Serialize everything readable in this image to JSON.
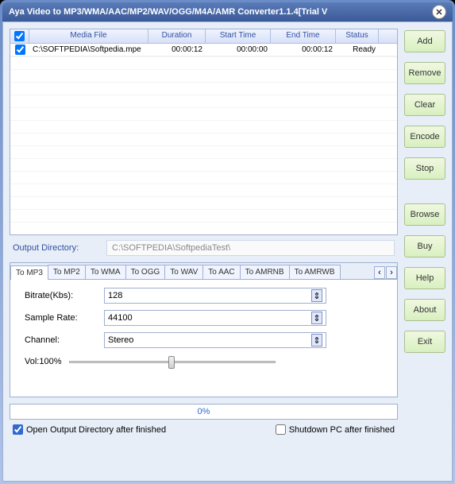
{
  "title": "Aya Video to MP3/WMA/AAC/MP2/WAV/OGG/M4A/AMR Converter1.1.4[Trial V",
  "table": {
    "headers": [
      "Media File",
      "Duration",
      "Start Time",
      "End Time",
      "Status"
    ],
    "rows": [
      {
        "checked": true,
        "file": "C:\\SOFTPEDIA\\Softpedia.mpe",
        "duration": "00:00:12",
        "start": "00:00:00",
        "end": "00:00:12",
        "status": "Ready"
      }
    ]
  },
  "sidebar": {
    "add": "Add",
    "remove": "Remove",
    "clear": "Clear",
    "encode": "Encode",
    "stop": "Stop",
    "browse": "Browse",
    "buy": "Buy",
    "help": "Help",
    "about": "About",
    "exit": "Exit"
  },
  "outdir": {
    "label": "Output Directory:",
    "value": "C:\\SOFTPEDIA\\SoftpediaTest\\"
  },
  "tabs": [
    "To MP3",
    "To MP2",
    "To WMA",
    "To OGG",
    "To WAV",
    "To AAC",
    "To AMRNB",
    "To AMRWB"
  ],
  "activeTab": 0,
  "settings": {
    "bitrate_label": "Bitrate(Kbs):",
    "bitrate_value": "128",
    "samplerate_label": "Sample Rate:",
    "samplerate_value": "44100",
    "channel_label": "Channel:",
    "channel_value": "Stereo",
    "vol_label": "Vol:100%"
  },
  "progress": "0%",
  "options": {
    "open_out": "Open Output Directory after finished",
    "shutdown": "Shutdown PC after finished"
  }
}
